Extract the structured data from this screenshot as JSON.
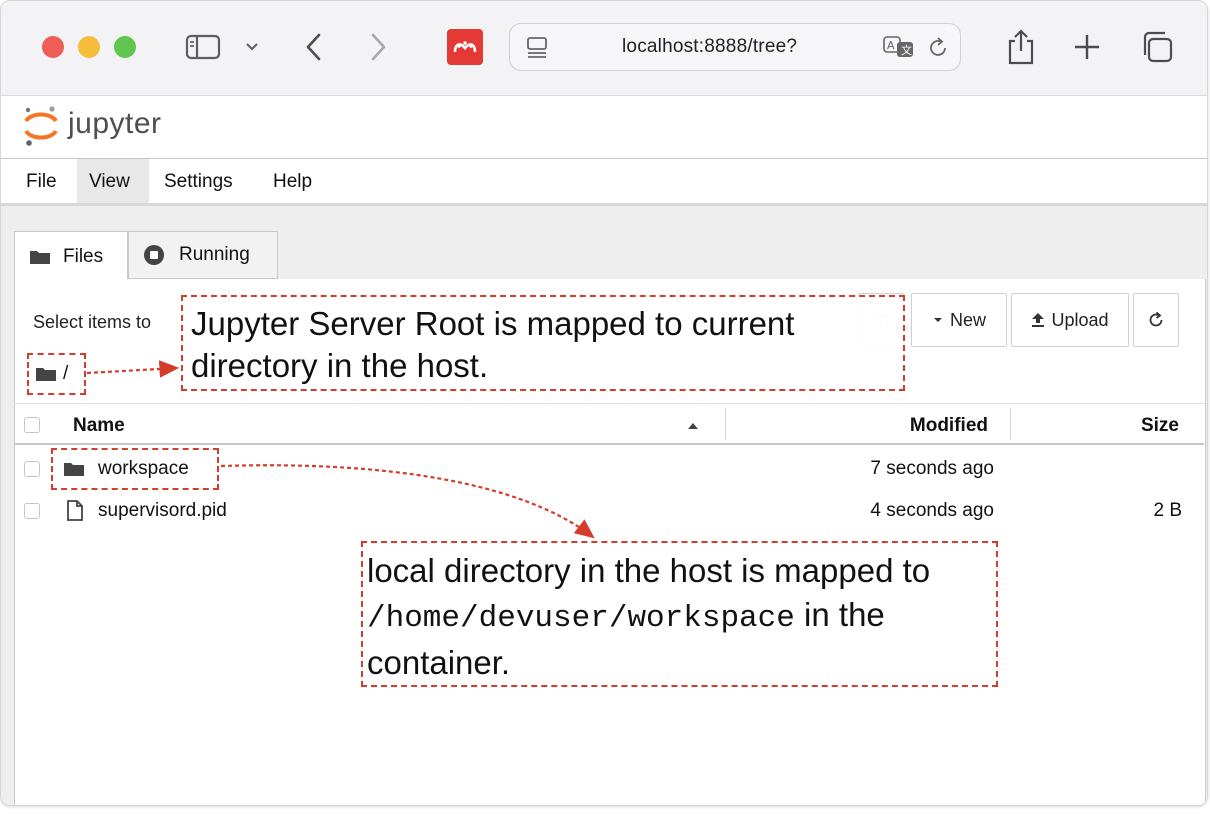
{
  "browser": {
    "address": "localhost:8888/tree?"
  },
  "app": {
    "logo_text": "jupyter"
  },
  "menu": [
    "File",
    "View",
    "Settings",
    "Help"
  ],
  "tabs": [
    {
      "label": "Files"
    },
    {
      "label": "Running"
    }
  ],
  "toolbar": {
    "select_hint": "Select items to",
    "new_label": "New",
    "upload_label": "Upload"
  },
  "breadcrumb": {
    "path": "/"
  },
  "table": {
    "columns": {
      "name": "Name",
      "modified": "Modified",
      "size": "Size"
    },
    "rows": [
      {
        "name": "workspace",
        "type": "folder",
        "modified": "7 seconds ago",
        "size": ""
      },
      {
        "name": "supervisord.pid",
        "type": "file",
        "modified": "4 seconds ago",
        "size": "2 B"
      }
    ]
  },
  "annotations": {
    "root_note": "Jupyter Server Root is mapped to current directory in the host.",
    "workspace_note_a": "local directory in the host is mapped to",
    "workspace_note_path": "/home/devuser/workspace",
    "workspace_note_b": "in the",
    "workspace_note_c": "container."
  },
  "colors": {
    "callout": "#d33d2c",
    "extension_red": "#e53935"
  }
}
